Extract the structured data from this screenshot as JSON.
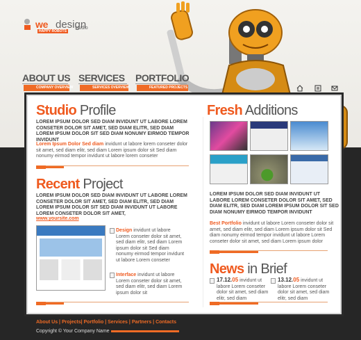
{
  "logo": {
    "we": "we",
    "design": "design",
    "studio": "studio",
    "tagline": "HAPPY ROBOTS"
  },
  "nav": [
    {
      "label": "ABOUT US",
      "sub": "COMPANY OVERVIEW"
    },
    {
      "label": "SERVICES",
      "sub": "SERVICES OVERVIEW"
    },
    {
      "label": "PORTFOLIO",
      "sub": "FEATURED PROJECTS"
    }
  ],
  "studio_profile": {
    "title_bold": "Studio",
    "title_rest": " Profile",
    "caps": "LOREM IPSUM DOLOR SED DIAM INVIDUNT UT LABORE LOREM CONSETER DOLOR SIT AMET, SED DIAM ELITR, SED DIAM LOREM IPSUM DOLOR SIT SED DIAM NONUMY EIRMOD TEMPOR INVIDUNT",
    "lead": "Lorem Ipsum Dolor Sed diam",
    "body": " invidunt ut labore lorem conseter dolor sit amet, sed diam elitr, sed diam Lorem ipsum dolor sit Sed diam nonumy eirmod tempor invidunt ut labore lorem conseter"
  },
  "recent_project": {
    "title_bold": "Recent",
    "title_rest": " Project",
    "caps": "LOREM IPSUM DOLOR SED DIAM INVIDUNT UT LABORE LOREM CONSETER DOLOR SIT AMET, SED DIAM ELITR, SED DIAM LOREM IPSUM DOLOR SIT SED DIAM INVIDUNT UT LABORE LOREM CONSETER DOLOR SIT AMET,",
    "url": "www.yoursite.com",
    "items": [
      {
        "label": "Design",
        "text": " invidunt ut labore Lorem conseter dolor sit amet, sed diam elitr, sed diam Lorem ipsum dolor sit Sed diam nonumy eirmod tempor invidunt ut labore Lorem conseter"
      },
      {
        "label": "Interface",
        "text": " invidunt ut labore Lorem conseter dolor sit amet, sed diam elitr, sed diam Lorem ipsum dolor sit"
      }
    ]
  },
  "fresh_additions": {
    "title_bold": "Fresh",
    "title_rest": " Additions",
    "caps": "LOREM IPSUM DOLOR SED DIAM INVIDUNT UT LABORE LOREM CONSETER DOLOR SIT AMET, SED DIAM ELITR, SED DIAM LOREM IPSUM DOLOR SIT SED DIAM NONUMY EIRMOD TEMPOR INVIDUNT",
    "lead": "Best Portfolio",
    "body": " invidunt ut labore Lorem conseter dolor sit amet, sed diam elitr, sed diam Lorem ipsum dolor sit Sed diam nonumy eirmod tempor invidunt ut labore Lorem conseter dolor sit amet, sed diam Lorem ipsum dolor"
  },
  "news": {
    "title_bold": "News",
    "title_rest": " in Brief",
    "items": [
      {
        "date": "17.12.",
        "year": "05",
        "text": " invidunt ut labore Lorem conseter dolor sit amet, sed diam elitr, sed diam"
      },
      {
        "date": "13.12.",
        "year": "05",
        "text": " invidunt ut labore Lorem conseter dolor sit amet, sed diam elitr, sed diam"
      }
    ]
  },
  "footer": {
    "links": [
      "About Us",
      "Projects",
      "Portfolio",
      "Services",
      "Partners",
      "Contacts"
    ],
    "copyright": "Copyright © Your Company Name"
  },
  "colors": {
    "accent": "#ef5a1f",
    "dark": "#262626"
  }
}
